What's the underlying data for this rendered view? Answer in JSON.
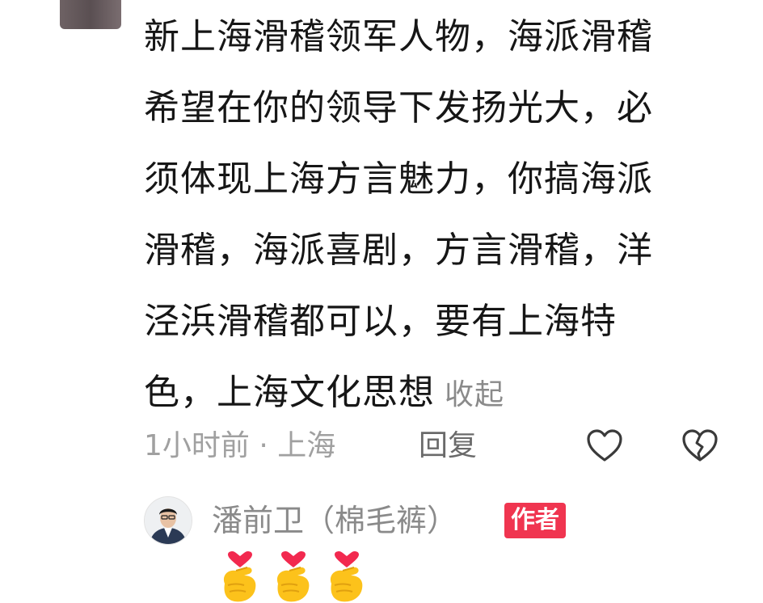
{
  "comment": {
    "lines": [
      "新上海滑稽领军人物，海派滑稽",
      "希望在你的领导下发扬光大，必",
      "须体现上海方言魅力，你搞海派",
      "滑稽，海派喜剧，方言滑稽，洋",
      "泾浜滑稽都可以，要有上海特",
      "色，上海文化思想"
    ],
    "collapse_label": "收起",
    "time_location": "1小时前 · 上海",
    "reply_label": "回复"
  },
  "reply": {
    "username": "潘前卫（棉毛裤）",
    "badge": "作者",
    "emoji_icons": [
      "finger-heart-icon",
      "finger-heart-icon",
      "finger-heart-icon"
    ]
  },
  "colors": {
    "text": "#161616",
    "meta": "#a0a0a0",
    "badge": "#f03550"
  }
}
